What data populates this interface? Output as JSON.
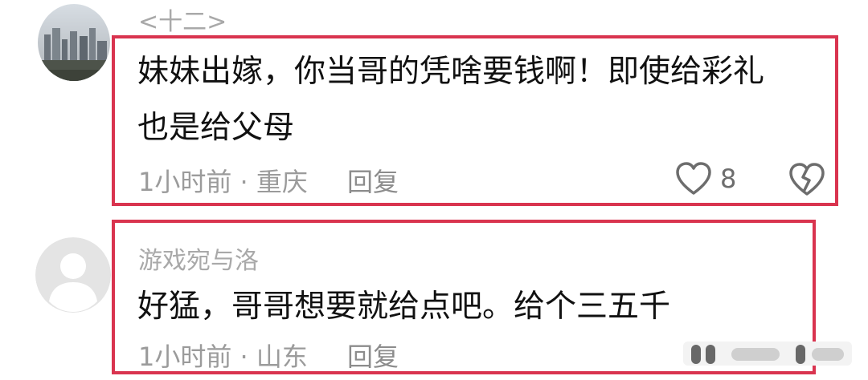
{
  "comments": [
    {
      "username": "<十二>",
      "text_line1": "妹妹出嫁，你当哥的凭啥要钱啊！即使给彩礼",
      "text_line2": "也是给父母",
      "time": "1小时前",
      "location": "重庆",
      "reply_label": "回复",
      "like_count": "8",
      "icons": {
        "like": "heart-outline-icon",
        "dislike": "broken-heart-icon"
      }
    },
    {
      "username": "游戏宛与洛",
      "text": "好猛，哥哥想要就给点吧。给个三五千",
      "time": "1小时前",
      "location": "山东",
      "reply_label": "回复"
    }
  ],
  "colors": {
    "highlight_border": "#d9344f",
    "username": "#a9a9a9",
    "meta": "#9b9b9b",
    "text": "#111111"
  }
}
